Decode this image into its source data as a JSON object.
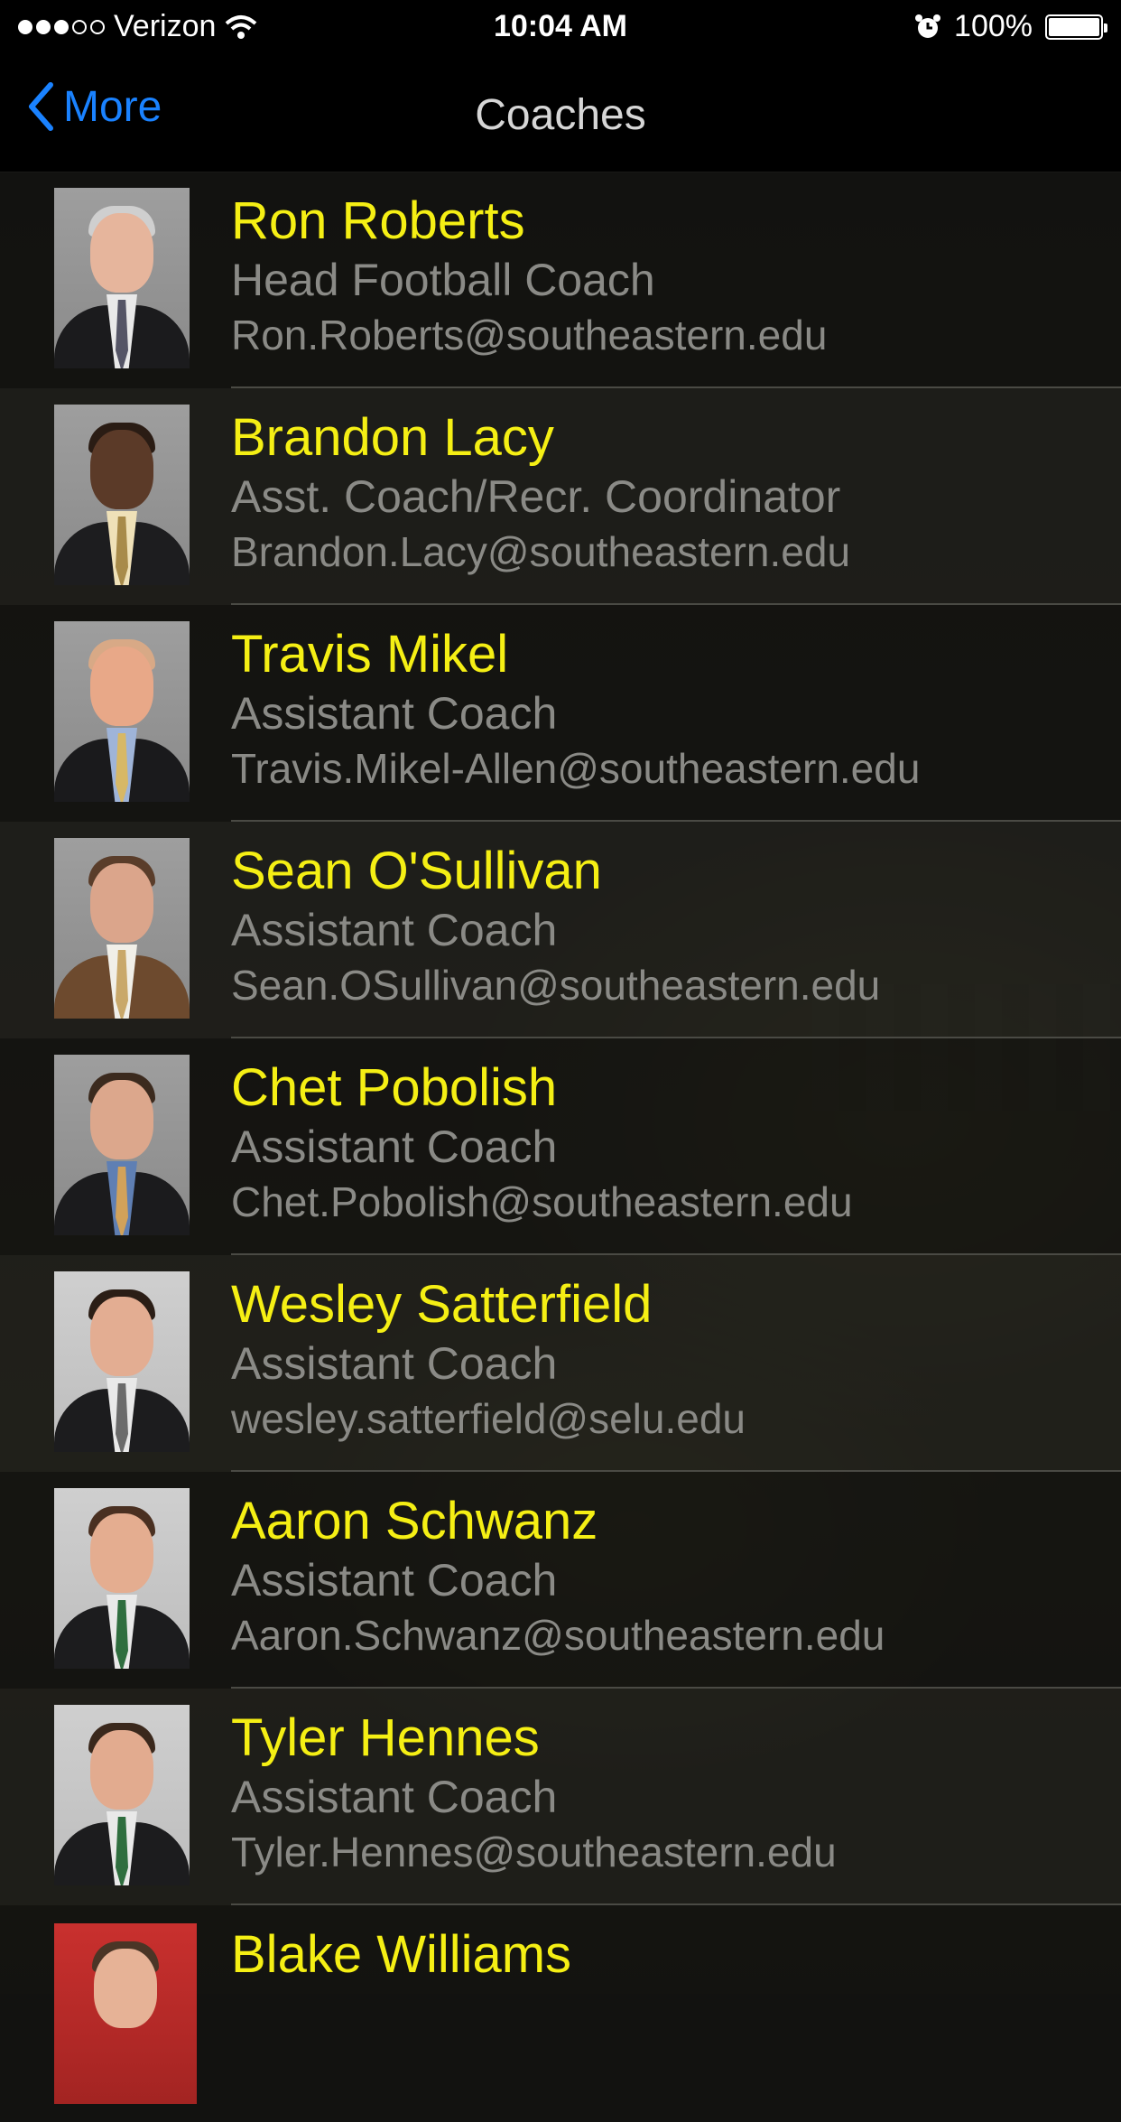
{
  "status_bar": {
    "carrier": "Verizon",
    "time": "10:04 AM",
    "battery": "100%",
    "signal_bars": 3,
    "signal_total": 5
  },
  "nav": {
    "back_label": "More",
    "title": "Coaches"
  },
  "coaches": [
    {
      "name": "Ron Roberts",
      "title": "Head Football Coach",
      "email": "Ron.Roberts@southeastern.edu"
    },
    {
      "name": "Brandon Lacy",
      "title": "Asst. Coach/Recr. Coordinator",
      "email": "Brandon.Lacy@southeastern.edu"
    },
    {
      "name": "Travis Mikel",
      "title": "Assistant Coach",
      "email": "Travis.Mikel-Allen@southeastern.edu"
    },
    {
      "name": "Sean O'Sullivan",
      "title": "Assistant Coach",
      "email": "Sean.OSullivan@southeastern.edu"
    },
    {
      "name": "Chet Pobolish",
      "title": "Assistant Coach",
      "email": "Chet.Pobolish@southeastern.edu"
    },
    {
      "name": "Wesley Satterfield",
      "title": "Assistant Coach",
      "email": "wesley.satterfield@selu.edu"
    },
    {
      "name": "Aaron Schwanz",
      "title": "Assistant Coach",
      "email": "Aaron.Schwanz@southeastern.edu"
    },
    {
      "name": "Tyler Hennes",
      "title": "Assistant Coach",
      "email": "Tyler.Hennes@southeastern.edu"
    },
    {
      "name": "Blake Williams",
      "title": "",
      "email": ""
    }
  ],
  "colors": {
    "accent": "#1a82ff",
    "name": "#f5ef14",
    "secondary_text": "#8a8a86"
  }
}
